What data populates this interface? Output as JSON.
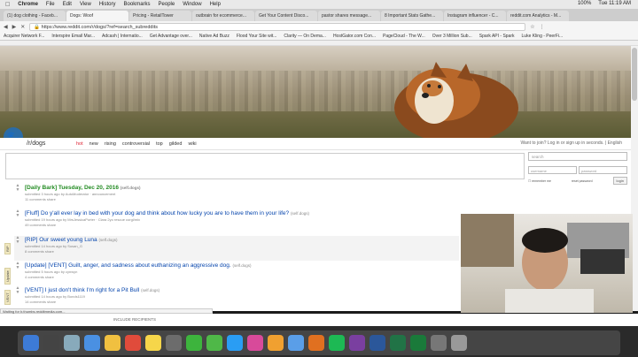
{
  "menubar": {
    "apple": "",
    "app": "Chrome",
    "items": [
      "File",
      "Edit",
      "View",
      "History",
      "Bookmarks",
      "People",
      "Window",
      "Help"
    ],
    "battery": "100%",
    "clock": "Tue 11:19 AM"
  },
  "tabs": [
    {
      "label": "(1) dog clothing - Faceb..."
    },
    {
      "label": "Dogs: Woof",
      "active": true
    },
    {
      "label": "Pricing - RetailTower"
    },
    {
      "label": "outbrain for ecommerce..."
    },
    {
      "label": "Get Your Content Disco..."
    },
    {
      "label": "pastor shares message..."
    },
    {
      "label": "8 Important Stats Gathe..."
    },
    {
      "label": "Instagram influencer - C..."
    },
    {
      "label": "reddit.com Analytics - M..."
    }
  ],
  "address": {
    "url": "https://www.reddit.com/r/dogs/?ref=search_subreddits"
  },
  "bookmarks": [
    "Acquirer Network F...",
    "Interspire Email Mar...",
    "Adcash | Internatio...",
    "Get Advantage over...",
    "Native Ad Buzz",
    "Flood Your Site wit...",
    "Clarity — On Dema...",
    "HostGator.com Con...",
    "PageCloud - The W...",
    "Over 3 Million Sub...",
    "Spark API - Spark",
    "Luke Kling - PeerFi..."
  ],
  "reddit": {
    "subreddit": "/r/dogs",
    "sort_tabs": [
      "hot",
      "new",
      "rising",
      "controversial",
      "top",
      "gilded",
      "wiki"
    ],
    "login_prompt": "Want to join? Log in or sign up in seconds. | English",
    "sidebar": {
      "search_placeholder": "search",
      "username_placeholder": "username",
      "password_placeholder": "password",
      "remember_me": "remember me",
      "reset_password": "reset password",
      "login_button": "login"
    },
    "posts": [
      {
        "title": "[Daily Bark] Tuesday, Dec 20, 2016",
        "domain": "(self.dogs)",
        "meta": "submitted 3 hours ago by AutoModerator · announcement",
        "acts": "11 comments  share",
        "daily": true
      },
      {
        "title": "[Fluff] Do y'all ever lay in bed with your dog and think about how lucky you are to have them in your life?",
        "domain": "(self.dogs)",
        "meta": "submitted 19 hours ago by MrsJessicaPorter · Clara 2yo rescue corgi/mix",
        "acts": "49 comments  share"
      },
      {
        "title": "[RIP] Our sweet young Luna",
        "domain": "(self.dogs)",
        "meta": "submitted 14 hours ago by Susan_G",
        "acts": "8 comments  share",
        "flair": "RIP",
        "hl": true
      },
      {
        "title": "[Update] [VENT] Guilt, anger, and sadness about euthanizing an aggressive dog.",
        "domain": "(self.dogs)",
        "meta": "submitted 5 hours ago by cynwyn",
        "acts": "4 comments  share",
        "flair": "Update"
      },
      {
        "title": "[VENT] I just don't think I'm right for a Pit Bull",
        "domain": "(self.dogs)",
        "meta": "submitted 14 hours ago by Bonds1119",
        "acts": "14 comments  share",
        "flair": "VENT"
      }
    ],
    "bottom_label": "INCLUDE RECIPIENTS"
  },
  "statusbar": "Waiting for b.thumbs.redditmedia.com...",
  "colors": {
    "accent": "#d23",
    "link": "#0645ad",
    "daily": "#228b22"
  }
}
